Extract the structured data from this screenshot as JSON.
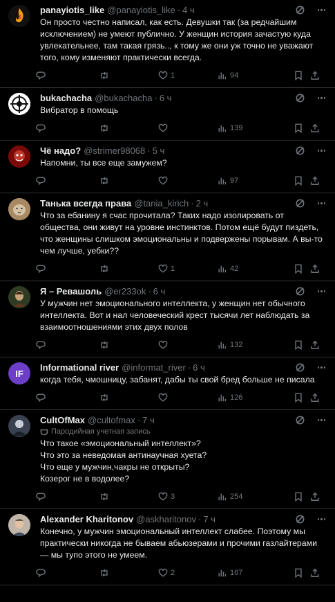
{
  "colors": {
    "background": "#000000",
    "text": "#e7e9ea",
    "secondary": "#71767b",
    "divider": "#2f3336"
  },
  "posts": [
    {
      "name": "panayiotis_like",
      "handle": "@panayiotis_like",
      "time": "4 ч",
      "text": "Он просто честно написал, как есть. Девушки так (за редчайшим исключением) не умеют публично. У женщин история зачастую куда увлекательнее, там такая грязь.., к тому же они уж точно не уважают того, кому изменяют практически всегда.",
      "replies": "",
      "retweets": "",
      "likes": "1",
      "views": "94",
      "avatar_color": "#111111",
      "avatar_icon": "fire-logo"
    },
    {
      "name": "bukachacha",
      "handle": "@bukachacha",
      "time": "6 ч",
      "text": "Вибратор в помощь",
      "replies": "",
      "retweets": "",
      "likes": "",
      "views": "139",
      "avatar_color": "#ffffff",
      "avatar_icon": "crosshair-logo"
    },
    {
      "name": "Чё надо?",
      "handle": "@strimer98068",
      "time": "5 ч",
      "text": "Напомни, ты все еще замужем?",
      "replies": "",
      "retweets": "",
      "likes": "",
      "views": "97",
      "avatar_color": "#8b0c0c",
      "avatar_icon": "red-character"
    },
    {
      "name": "Танька всегда права",
      "handle": "@tania_kirich",
      "time": "2 ч",
      "text": "Что за ебанину я счас прочитала? Таких надо изолировать от общества, они живут на уровне инстинктов. Потом ещё будут пиздеть, что женщины слишком эмоциональны и подвержены порывам. А вы-то чем лучше, уебки??",
      "replies": "",
      "retweets": "",
      "likes": "1",
      "views": "42",
      "avatar_color": "#b0977a",
      "avatar_icon": "lion-photo"
    },
    {
      "name": "Я – Ревашоль",
      "handle": "@er233ok",
      "time": "6 ч",
      "text": "У мужчин нет эмоционального интеллекта, у женщин нет обычного интеллекта. Вот и нал человеческий крест тысячи лет наблюдать за взаимоотношениями этих двух полов",
      "replies": "",
      "retweets": "",
      "likes": "",
      "views": "132",
      "avatar_color": "#3a4a2a",
      "avatar_icon": "painting-portrait"
    },
    {
      "name": "Informational river",
      "handle": "@informat_river",
      "time": "6 ч",
      "text": "когда тебя, чмошницу, забанят, дабы ты свой бред больше не писала",
      "replies": "",
      "retweets": "",
      "likes": "",
      "views": "126",
      "avatar_color": "#6d3fc8",
      "avatar_icon": "IF"
    },
    {
      "name": "CultOfMax",
      "handle": "@cultofmax",
      "time": "7 ч",
      "parody": "Пародийная учетная запись",
      "text": "Что такое «эмоциональный интеллект»?\nЧто это за неведомая антинаучная хуета?\nЧто еще у мужчин,чакры не открыты?\nКозерог не в водолее?",
      "replies": "",
      "retweets": "",
      "likes": "3",
      "views": "254",
      "avatar_color": "#2a2e36",
      "avatar_icon": "dark-figure"
    },
    {
      "name": "Alexander Kharitonov",
      "handle": "@askharitonov",
      "time": "7 ч",
      "text": "Конечно, у мужчин эмоциональный интеллект слабее. Поэтому мы практически никогда не бываем абьюзерами и прочими газлайтерами — мы тупо этого не умеем.",
      "replies": "",
      "retweets": "",
      "likes": "2",
      "views": "167",
      "avatar_color": "#c9c0b4",
      "avatar_icon": "man-photo"
    }
  ]
}
